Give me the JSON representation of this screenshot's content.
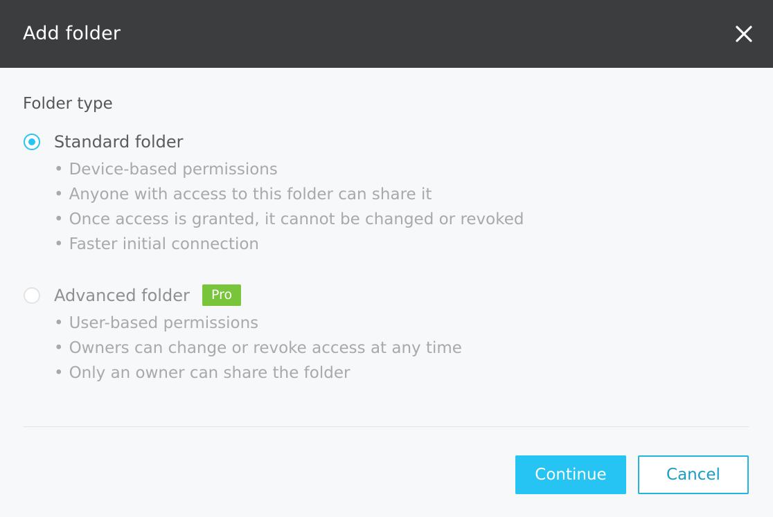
{
  "dialog": {
    "title": "Add folder",
    "close_icon": "close-icon"
  },
  "folder_type": {
    "heading": "Folder type",
    "options": [
      {
        "label": "Standard folder",
        "selected": true,
        "bullets": [
          "Device-based permissions",
          "Anyone with access to this folder can share it",
          "Once access is granted, it cannot be changed or revoked",
          "Faster initial connection"
        ]
      },
      {
        "label": "Advanced folder",
        "selected": false,
        "badge": "Pro",
        "bullets": [
          "User-based permissions",
          "Owners can change or revoke access at any time",
          "Only an owner can share the folder"
        ]
      }
    ]
  },
  "actions": {
    "continue_label": "Continue",
    "cancel_label": "Cancel"
  },
  "colors": {
    "header_bg": "#3c3d3e",
    "accent": "#25c4f2",
    "pro_badge": "#78c43a"
  }
}
